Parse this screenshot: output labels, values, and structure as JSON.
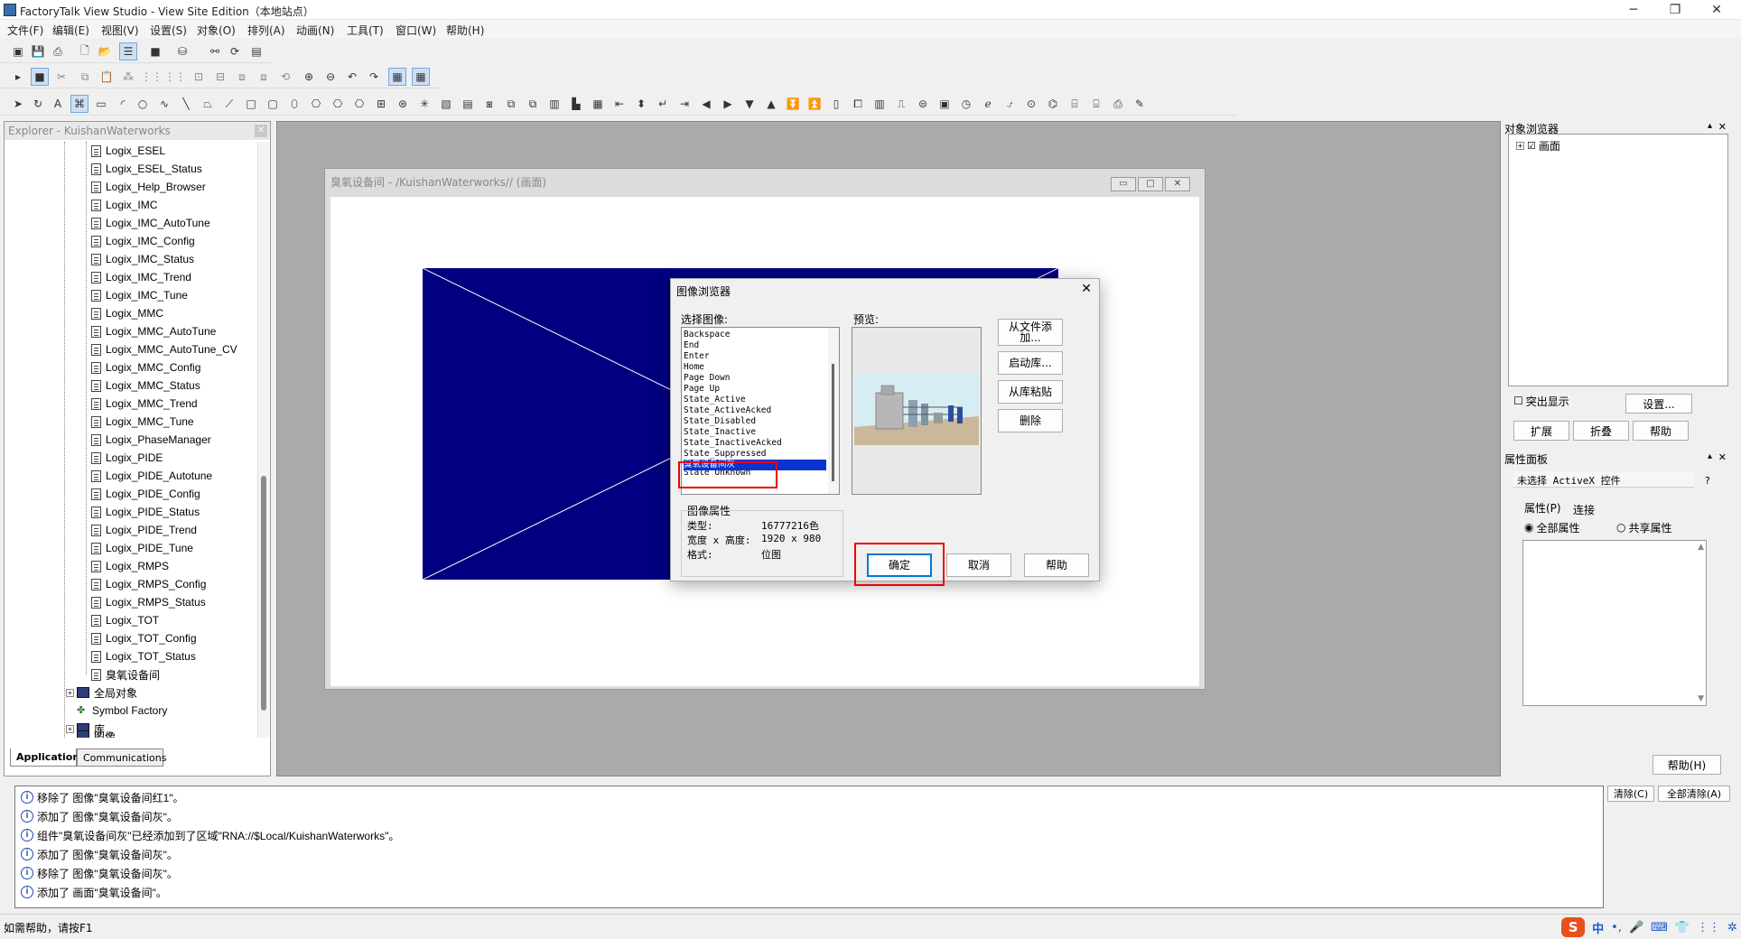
{
  "window": {
    "title": "FactoryTalk View Studio - View Site Edition（本地站点）",
    "controls": [
      "─",
      "❐",
      "✕"
    ]
  },
  "menu": [
    "文件(F)",
    "编辑(E)",
    "视图(V)",
    "设置(S)",
    "对象(O)",
    "排列(A)",
    "动画(N)",
    "工具(T)",
    "窗口(W)",
    "帮助(H)"
  ],
  "explorer": {
    "title": "Explorer - KuishanWaterworks",
    "items": [
      "Logix_ESEL",
      "Logix_ESEL_Status",
      "Logix_Help_Browser",
      "Logix_IMC",
      "Logix_IMC_AutoTune",
      "Logix_IMC_Config",
      "Logix_IMC_Status",
      "Logix_IMC_Trend",
      "Logix_IMC_Tune",
      "Logix_MMC",
      "Logix_MMC_AutoTune",
      "Logix_MMC_AutoTune_CV",
      "Logix_MMC_Config",
      "Logix_MMC_Status",
      "Logix_MMC_Trend",
      "Logix_MMC_Tune",
      "Logix_PhaseManager",
      "Logix_PIDE",
      "Logix_PIDE_Autotune",
      "Logix_PIDE_Config",
      "Logix_PIDE_Status",
      "Logix_PIDE_Trend",
      "Logix_PIDE_Tune",
      "Logix_RMPS",
      "Logix_RMPS_Config",
      "Logix_RMPS_Status",
      "Logix_TOT",
      "Logix_TOT_Config",
      "Logix_TOT_Status",
      "臭氧设备间"
    ],
    "folders": [
      "全局对象",
      "Symbol Factory",
      "库",
      "图像"
    ],
    "tabs": [
      "Application",
      "Communications"
    ]
  },
  "display_window": {
    "title": "臭氧设备间 - /KuishanWaterworks// (画面)"
  },
  "dialog": {
    "title": "图像浏览器",
    "select_label": "选择图像:",
    "preview_label": "预览:",
    "images": [
      "Backspace",
      "End",
      "Enter",
      "Home",
      "Page Down",
      "Page Up",
      "State_Active",
      "State_ActiveAcked",
      "State_Disabled",
      "State_Inactive",
      "State_InactiveAcked",
      "State_Suppressed",
      "臭氧设备间灰",
      "State_Unknown"
    ],
    "selected_image": "臭氧设备间灰",
    "side_buttons": [
      "从文件添加...",
      "启动库...",
      "从库粘贴",
      "删除"
    ],
    "props_title": "图像属性",
    "props": {
      "type_label": "类型:",
      "type_value": "16777216色",
      "size_label": "宽度 x 高度:",
      "size_value": "1920 x 980",
      "format_label": "格式:",
      "format_value": "位图"
    },
    "ok": "确定",
    "cancel": "取消",
    "help": "帮助"
  },
  "object_browser": {
    "title": "对象浏览器",
    "root": "画面",
    "highlight_label": "突出显示",
    "settings": "设置...",
    "expand": "扩展",
    "collapse": "折叠",
    "help": "帮助"
  },
  "property_panel": {
    "title": "属性面板",
    "selection": "未选择 ActiveX 控件",
    "tab_props": "属性(P)",
    "tab_conn": "连接",
    "all_props": "全部属性",
    "shared_props": "共享属性",
    "help": "帮助(H)"
  },
  "log": {
    "lines": [
      "移除了 图像\"臭氧设备间红1\"。",
      "添加了 图像\"臭氧设备间灰\"。",
      "组件\"臭氧设备间灰\"已经添加到了区域\"RNA://$Local/KuishanWaterworks\"。",
      "添加了 图像\"臭氧设备间灰\"。",
      "移除了 图像\"臭氧设备间灰\"。",
      "添加了 画面\"臭氧设备间\"。"
    ],
    "clear": "清除(C)",
    "clear_all": "全部清除(A)"
  },
  "status": {
    "text": "如需帮助，请按F1"
  },
  "tray": {
    "ime_logo": "S",
    "ime_lang": "中",
    "items": [
      "•,",
      "🎤",
      "⌨",
      "👕",
      "⋮⋮",
      "✲"
    ]
  },
  "colors": {
    "canvas_image": "#000080",
    "selection": "#0a34d0",
    "highlight_box": "#ee0000"
  }
}
